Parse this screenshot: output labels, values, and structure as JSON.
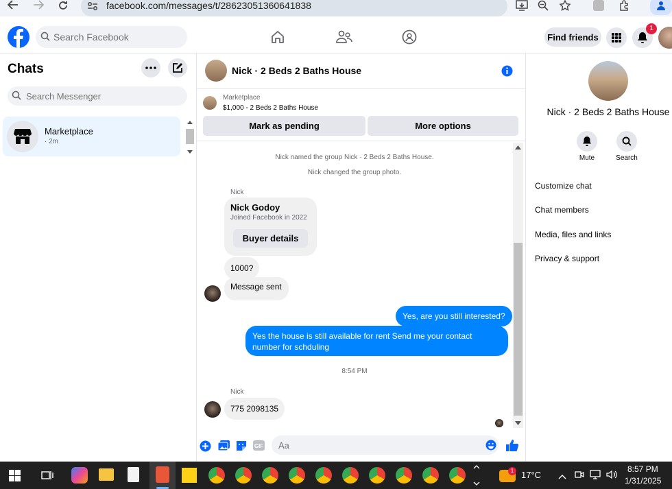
{
  "browser": {
    "url": "facebook.com/messages/t/28623051360641838"
  },
  "header": {
    "search_placeholder": "Search Facebook",
    "find_friends_label": "Find friends",
    "notification_count": "1"
  },
  "chats": {
    "title": "Chats",
    "search_placeholder": "Search Messenger",
    "items": [
      {
        "name": "Marketplace",
        "time": "· 2m"
      }
    ]
  },
  "conversation": {
    "title": "Nick · 2 Beds 2 Baths House",
    "marketplace": {
      "label": "Marketplace",
      "item": "$1,000 - 2 Beds 2 Baths House",
      "pending_button": "Mark as pending",
      "more_button": "More options"
    },
    "system_messages": [
      "Nick named the group Nick · 2 Beds 2 Baths House.",
      "Nick changed the group photo."
    ],
    "sender_1": "Nick",
    "card": {
      "name": "Nick Godoy",
      "subtitle": "Joined Facebook in 2022",
      "button": "Buyer details"
    },
    "incoming_1": "1000?",
    "incoming_2": "Message sent",
    "outgoing_1": "Yes, are you still interested?",
    "outgoing_2": "Yes the house is still available for rent Send me your contact number for schduling",
    "timestamp": "8:54 PM",
    "sender_2": "Nick",
    "incoming_3": "775 2098135",
    "composer_placeholder": "Aa"
  },
  "info_panel": {
    "name": "Nick · 2 Beds 2 Baths House",
    "actions": [
      {
        "label": "Mute"
      },
      {
        "label": "Search"
      }
    ],
    "links": [
      "Customize chat",
      "Chat members",
      "Media, files and links",
      "Privacy & support"
    ]
  },
  "taskbar": {
    "weather": "17°C",
    "time": "8:57 PM",
    "date": "1/31/2025",
    "weather_badge": "1"
  },
  "colors": {
    "brand": "#0866ff",
    "outgoing_bubble": "#0084ff",
    "selected_chat": "#ebf5ff",
    "badge": "#e41e3f"
  }
}
